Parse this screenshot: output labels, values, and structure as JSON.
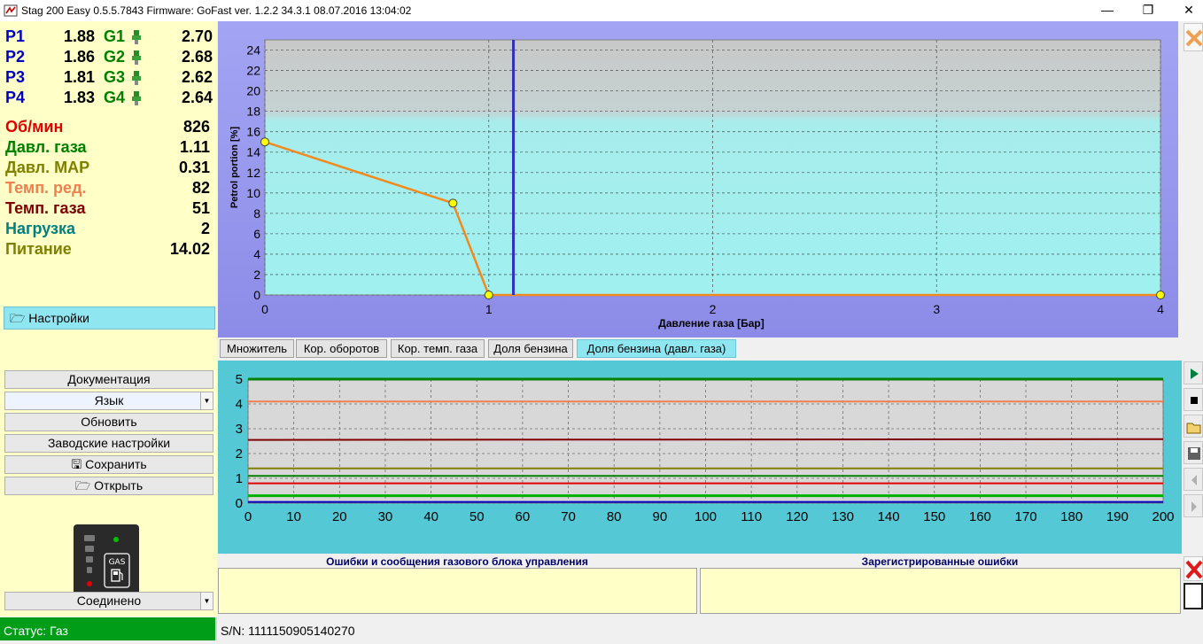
{
  "window": {
    "title": "Stag 200 Easy 0.5.5.7843 Firmware: GoFast  ver. 1.2.2  34.3.1   08.07.2016 13:04:02",
    "minimize": "—",
    "restore": "❐",
    "close": "✕"
  },
  "injectors": [
    {
      "p_label": "P1",
      "p_value": "1.88",
      "g_label": "G1",
      "g_value": "2.70"
    },
    {
      "p_label": "P2",
      "p_value": "1.86",
      "g_label": "G2",
      "g_value": "2.68"
    },
    {
      "p_label": "P3",
      "p_value": "1.81",
      "g_label": "G3",
      "g_value": "2.62"
    },
    {
      "p_label": "P4",
      "p_value": "1.83",
      "g_label": "G4",
      "g_value": "2.64"
    }
  ],
  "parameters": [
    {
      "label": "Об/мин",
      "value": "826",
      "color": "#e00000"
    },
    {
      "label": "Давл. газа",
      "value": "1.11",
      "color": "#008000"
    },
    {
      "label": "Давл. MAP",
      "value": "0.31",
      "color": "#808000"
    },
    {
      "label": "Темп. ред.",
      "value": "82",
      "color": "#f08050"
    },
    {
      "label": "Темп. газа",
      "value": "51",
      "color": "#800000"
    },
    {
      "label": "Нагрузка",
      "value": "2",
      "color": "#008080"
    },
    {
      "label": "Питание",
      "value": "14.02",
      "color": "#808000"
    }
  ],
  "sidebar": {
    "settings": "Настройки",
    "documentation": "Документация",
    "language": "Язык",
    "refresh": "Обновить",
    "factory_settings": "Заводские настройки",
    "save": "Сохранить",
    "open": "Открыть",
    "gas_label": "GAS",
    "connection": "Соединено"
  },
  "tabs": [
    "Множитель",
    "Кор. оборотов",
    "Кор. темп. газа",
    "Доля бензина",
    "Доля бензина (давл. газа)"
  ],
  "active_tab": 4,
  "status": {
    "mode": "Статус: Газ",
    "serial": "S/N: 1111150905140270"
  },
  "messages": {
    "ecu_errors_title": "Ошибки и сообщения газового блока управления",
    "registered_errors_title": "Зарегистрированные ошибки"
  },
  "colors": {
    "panel_yellow": "#ffffc8",
    "accent_cyan": "#55c8d6",
    "status_green": "#009e18",
    "curve_orange": "#f08a1e",
    "marker_blue": "#3030c0"
  },
  "chart_data": [
    {
      "type": "line",
      "title": "",
      "xlabel": "Давление газа [Бар]",
      "ylabel": "Petrol portion [%]",
      "xlim": [
        0,
        4
      ],
      "ylim": [
        0,
        25
      ],
      "xticks": [
        0,
        1,
        2,
        3,
        4
      ],
      "yticks": [
        0,
        2,
        4,
        6,
        8,
        10,
        12,
        14,
        16,
        18,
        20,
        22,
        24
      ],
      "grid": true,
      "x": [
        0,
        0.84,
        1.0,
        4.0
      ],
      "y": [
        15,
        9,
        0,
        0
      ],
      "marker_x": 1.11
    },
    {
      "type": "line",
      "title": "",
      "xlim": [
        0,
        200
      ],
      "ylim": [
        0,
        5
      ],
      "xticks": [
        0,
        10,
        20,
        30,
        40,
        50,
        60,
        70,
        80,
        90,
        100,
        110,
        120,
        130,
        140,
        150,
        160,
        170,
        180,
        190,
        200
      ],
      "yticks": [
        0,
        1,
        2,
        3,
        4,
        5
      ],
      "grid": true,
      "series": [
        {
          "color": "#008000",
          "values": [
            5.0,
            5.0
          ]
        },
        {
          "color": "#f08050",
          "values": [
            4.1,
            4.1
          ]
        },
        {
          "color": "#800000",
          "values": [
            2.55,
            2.58
          ]
        },
        {
          "color": "#808000",
          "values": [
            1.4,
            1.4
          ]
        },
        {
          "color": "#008000",
          "values": [
            1.1,
            1.1
          ]
        },
        {
          "color": "#e00000",
          "values": [
            0.8,
            0.8
          ]
        },
        {
          "color": "#00b000",
          "values": [
            0.3,
            0.3
          ]
        },
        {
          "color": "#0000c0",
          "values": [
            0.05,
            0.05
          ]
        }
      ]
    }
  ]
}
